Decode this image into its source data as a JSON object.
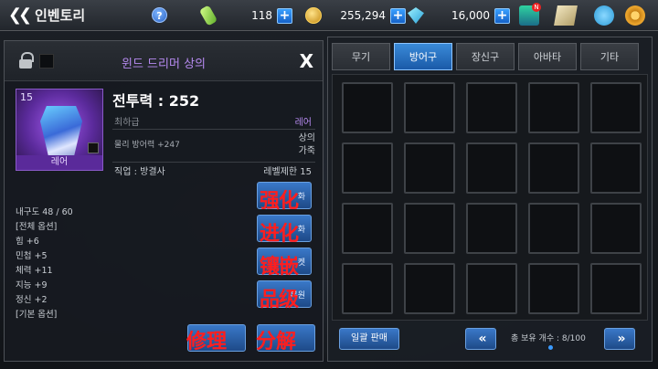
{
  "header": {
    "title": "인벤토리",
    "help": "?",
    "stamina": "118",
    "gold": "255,294",
    "gems": "16,000",
    "plus": "+",
    "shop_badge": "N"
  },
  "item": {
    "name": "윈드 드리머 상의",
    "close": "X",
    "level": "15",
    "rarity_badge": "레어",
    "combat_power": "전투력 : 252",
    "rank": "최하급",
    "rarity": "레어",
    "phys_def": "물리 방어력 +247",
    "slot_type_1": "상의",
    "slot_type_2": "가죽",
    "job": "직업 : 방결사",
    "level_limit": "레벨제한 15",
    "stats": [
      "내구도 48 / 60",
      "[전체 옵션]",
      "힘 +6",
      "민첩 +5",
      "체력 +11",
      "지능 +9",
      "정신 +2",
      "[기본 옵션]"
    ]
  },
  "actions": {
    "enhance_small": "화",
    "enhance_big": "强化",
    "evolve_small": "화",
    "evolve_big": "进化",
    "socket_small": "켓",
    "socket_big": "镶嵌",
    "grade_small": "복원",
    "grade_big": "品级",
    "repair_big": "修理",
    "dismantle_big": "分解"
  },
  "inventory": {
    "tabs": [
      "무기",
      "방어구",
      "장신구",
      "아바타",
      "기타"
    ],
    "active_tab": 1,
    "sell_all": "일괄 판매",
    "prev": "«",
    "next": "»",
    "count": "총 보유 개수 : 8/100"
  }
}
